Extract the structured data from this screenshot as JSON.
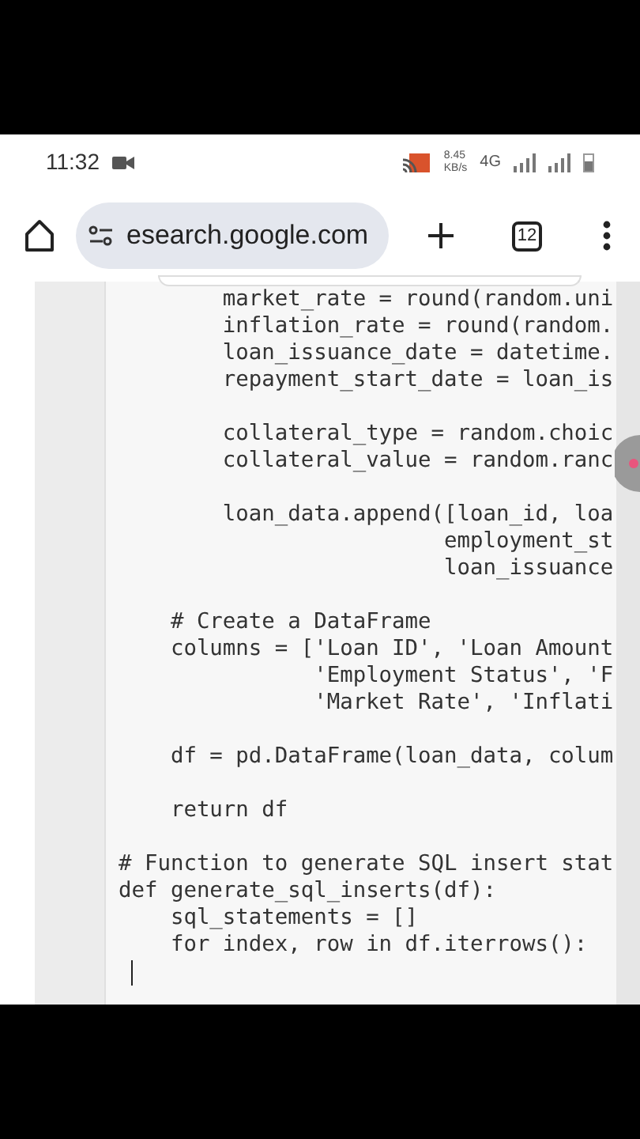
{
  "status_bar": {
    "time": "11:32",
    "speed": [
      "8.45",
      "KB/s"
    ],
    "network": "4G"
  },
  "toolbar": {
    "url": "esearch.google.com",
    "tab_count": "12"
  },
  "code": {
    "blocks": [
      [
        "        market_rate = round(random.uni",
        "        inflation_rate = round(random.",
        "        loan_issuance_date = datetime.",
        "        repayment_start_date = loan_is"
      ],
      [
        "        collateral_type = random.choic",
        "        collateral_value = random.ranc"
      ],
      [
        "        loan_data.append([loan_id, loa",
        "                         employment_st",
        "                         loan_issuance"
      ],
      [
        "    # Create a DataFrame",
        "    columns = ['Loan ID', 'Loan Amount",
        "               'Employment Status', 'F",
        "               'Market Rate', 'Inflati"
      ],
      [
        "    df = pd.DataFrame(loan_data, colum"
      ],
      [
        "    return df"
      ],
      [
        "# Function to generate SQL insert stat",
        "def generate_sql_inserts(df):",
        "    sql_statements = []",
        "    for index, row in df.iterrows():"
      ]
    ]
  }
}
